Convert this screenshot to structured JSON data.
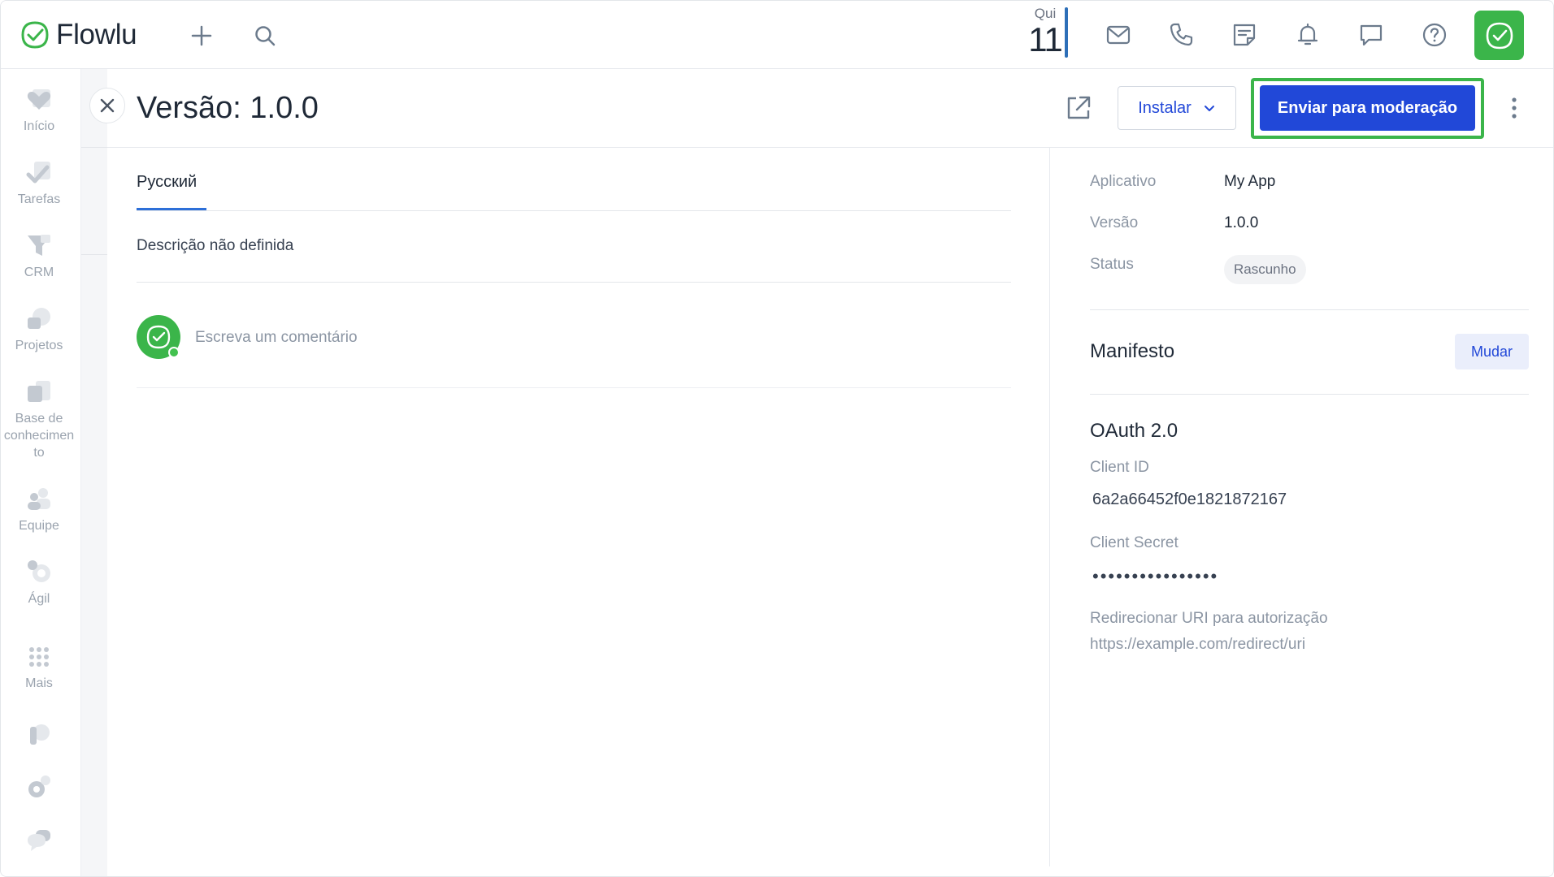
{
  "app": {
    "name": "Flowlu"
  },
  "topbar": {
    "date_day": "Qui",
    "date_num": "11",
    "icons": [
      "mail-icon",
      "phone-icon",
      "notes-icon",
      "bell-icon",
      "chat-icon",
      "help-icon"
    ]
  },
  "sidebar": {
    "items": [
      {
        "label": "Início",
        "icon": "heart-icon"
      },
      {
        "label": "Tarefas",
        "icon": "tasks-icon"
      },
      {
        "label": "CRM",
        "icon": "funnel-icon"
      },
      {
        "label": "Projetos",
        "icon": "projects-icon"
      },
      {
        "label": "Base de conhecimen to",
        "icon": "knowledge-icon"
      },
      {
        "label": "Equipe",
        "icon": "team-icon"
      },
      {
        "label": "Ágil",
        "icon": "agile-icon"
      },
      {
        "label": "Mais",
        "icon": "grid-icon"
      }
    ]
  },
  "panel": {
    "title": "Versão: 1.0.0",
    "install_label": "Instalar",
    "submit_label": "Enviar para moderação",
    "tab_label": "Русский",
    "description": "Descrição não definida",
    "comment_placeholder": "Escreva um comentário"
  },
  "details": {
    "app_label": "Aplicativo",
    "app_value": "My App",
    "version_label": "Versão",
    "version_value": "1.0.0",
    "status_label": "Status",
    "status_value": "Rascunho",
    "manifest_title": "Manifesto",
    "change_label": "Mudar",
    "oauth_title": "OAuth 2.0",
    "client_id_label": "Client ID",
    "client_id_value": "6a2a66452f0e1821872167",
    "client_secret_label": "Client Secret",
    "client_secret_value": "••••••••••••••••",
    "redirect_label": "Redirecionar URI para autorização",
    "redirect_value": "https://example.com/redirect/uri"
  },
  "colors": {
    "brand_green": "#3bb54a",
    "primary_blue": "#2148d8",
    "highlight_green": "#3bb54a"
  }
}
